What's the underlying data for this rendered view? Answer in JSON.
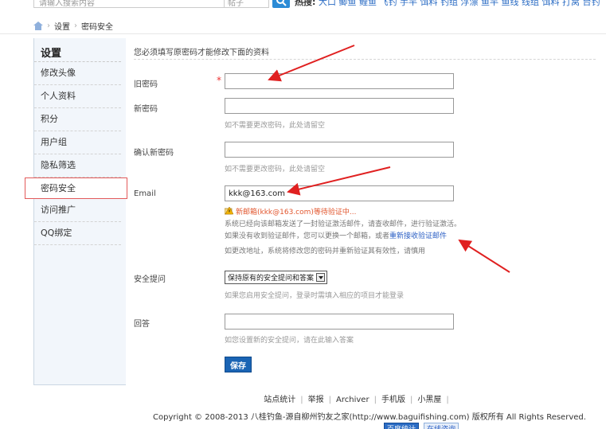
{
  "topbar": {
    "search_placeholder": "请输入搜索内容",
    "search_type": "帖子",
    "hot_label": "热搜:",
    "hot_links": "大口 鲫鱼 鲤鱼 飞钓 手竿 饵料 钓组 浮漂 鱼竿 鱼线 线组 饵料 打窝 台钓"
  },
  "breadcrumb": {
    "home_icon": "home-icon",
    "items": [
      "设置",
      "密码安全"
    ]
  },
  "sidebar": {
    "title": "设置",
    "items": [
      {
        "label": "修改头像"
      },
      {
        "label": "个人资料"
      },
      {
        "label": "积分"
      },
      {
        "label": "用户组"
      },
      {
        "label": "隐私筛选"
      },
      {
        "label": "密码安全"
      },
      {
        "label": "访问推广"
      },
      {
        "label": "QQ绑定"
      }
    ],
    "active_index": 5
  },
  "form": {
    "notice": "您必须填写原密码才能修改下面的资料",
    "old_password": {
      "label": "旧密码",
      "required_mark": "*",
      "value": ""
    },
    "new_password": {
      "label": "新密码",
      "value": "",
      "hint": "如不需要更改密码，此处请留空"
    },
    "confirm_password": {
      "label": "确认新密码",
      "value": "",
      "hint": "如不需要更改密码，此处请留空"
    },
    "email": {
      "label": "Email",
      "value": "kkk@163.com",
      "pending": "新邮箱(kkk@163.com)等待验证中...",
      "line1": "系统已经向该邮箱发送了一封验证激活邮件，请查收邮件，进行验证激活。",
      "line2_prefix": "如果没有收到验证邮件，您可以更换一个邮箱，或者",
      "line2_link": "重新接收验证邮件",
      "line3": "如更改地址，系统将修改您的密码并重新验证其有效性，请慎用"
    },
    "security_question": {
      "label": "安全提问",
      "selected": "保持原有的安全提问和答案",
      "hint": "如果您启用安全提问，登录时需填入相应的项目才能登录"
    },
    "answer": {
      "label": "回答",
      "value": "",
      "hint": "如您设置新的安全提问，请在此输入答案"
    },
    "save_label": "保存"
  },
  "footer": {
    "links": [
      "站点统计",
      "举报",
      "Archiver",
      "手机版",
      "小黑屋"
    ],
    "copyright": "Copyright © 2008-2013 八桂钓鱼-源自柳州钓友之家(http://www.baguifishing.com) 版权所有 All Rights Reserved.",
    "badges": [
      "百度统计",
      "在线咨询"
    ]
  },
  "colors": {
    "accent": "#1a64b4",
    "link": "#2b5fc4",
    "warning": "#e2572f",
    "annotation": "#e02020"
  }
}
